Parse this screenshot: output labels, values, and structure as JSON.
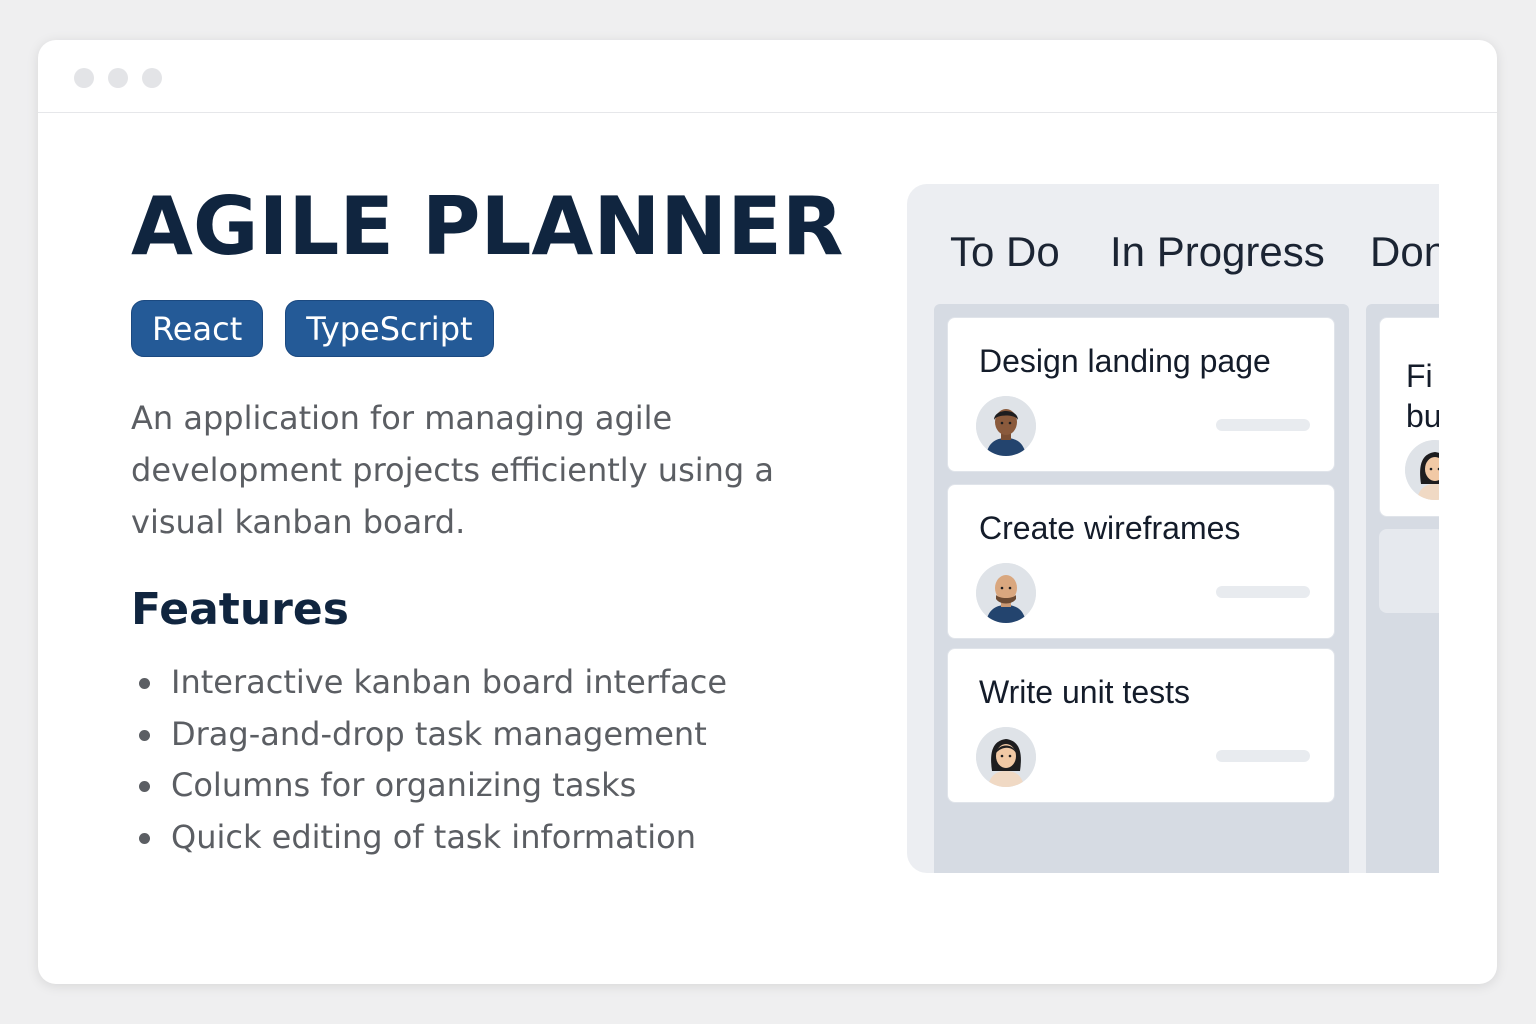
{
  "app": {
    "title": "AGILE PLANNER",
    "badges": [
      "React",
      "TypeScript"
    ],
    "description": "An application for managing agile development projects efficiently using a visual kanban board.",
    "features_heading": "Features",
    "features": [
      "Interactive kanban board interface",
      "Drag-and-drop task management",
      "Columns for organizing tasks",
      "Quick editing of task information"
    ]
  },
  "board": {
    "columns": [
      "To Do",
      "In Progress",
      "Don"
    ],
    "todo_cards": [
      {
        "title": "Design landing page",
        "avatar": "man-avatar-dark-skin"
      },
      {
        "title": "Create wireframes",
        "avatar": "man-avatar-bald"
      },
      {
        "title": "Write unit tests",
        "avatar": "woman-avatar"
      }
    ],
    "progress_card": {
      "title_line1": "Fi",
      "title_line2": "bu",
      "avatar": "woman-avatar"
    }
  },
  "colors": {
    "title": "#10253f",
    "badge": "#245a97",
    "body_text": "#5b5e63",
    "board_bg": "#eceef2",
    "column_bg": "#d6dbe3"
  }
}
